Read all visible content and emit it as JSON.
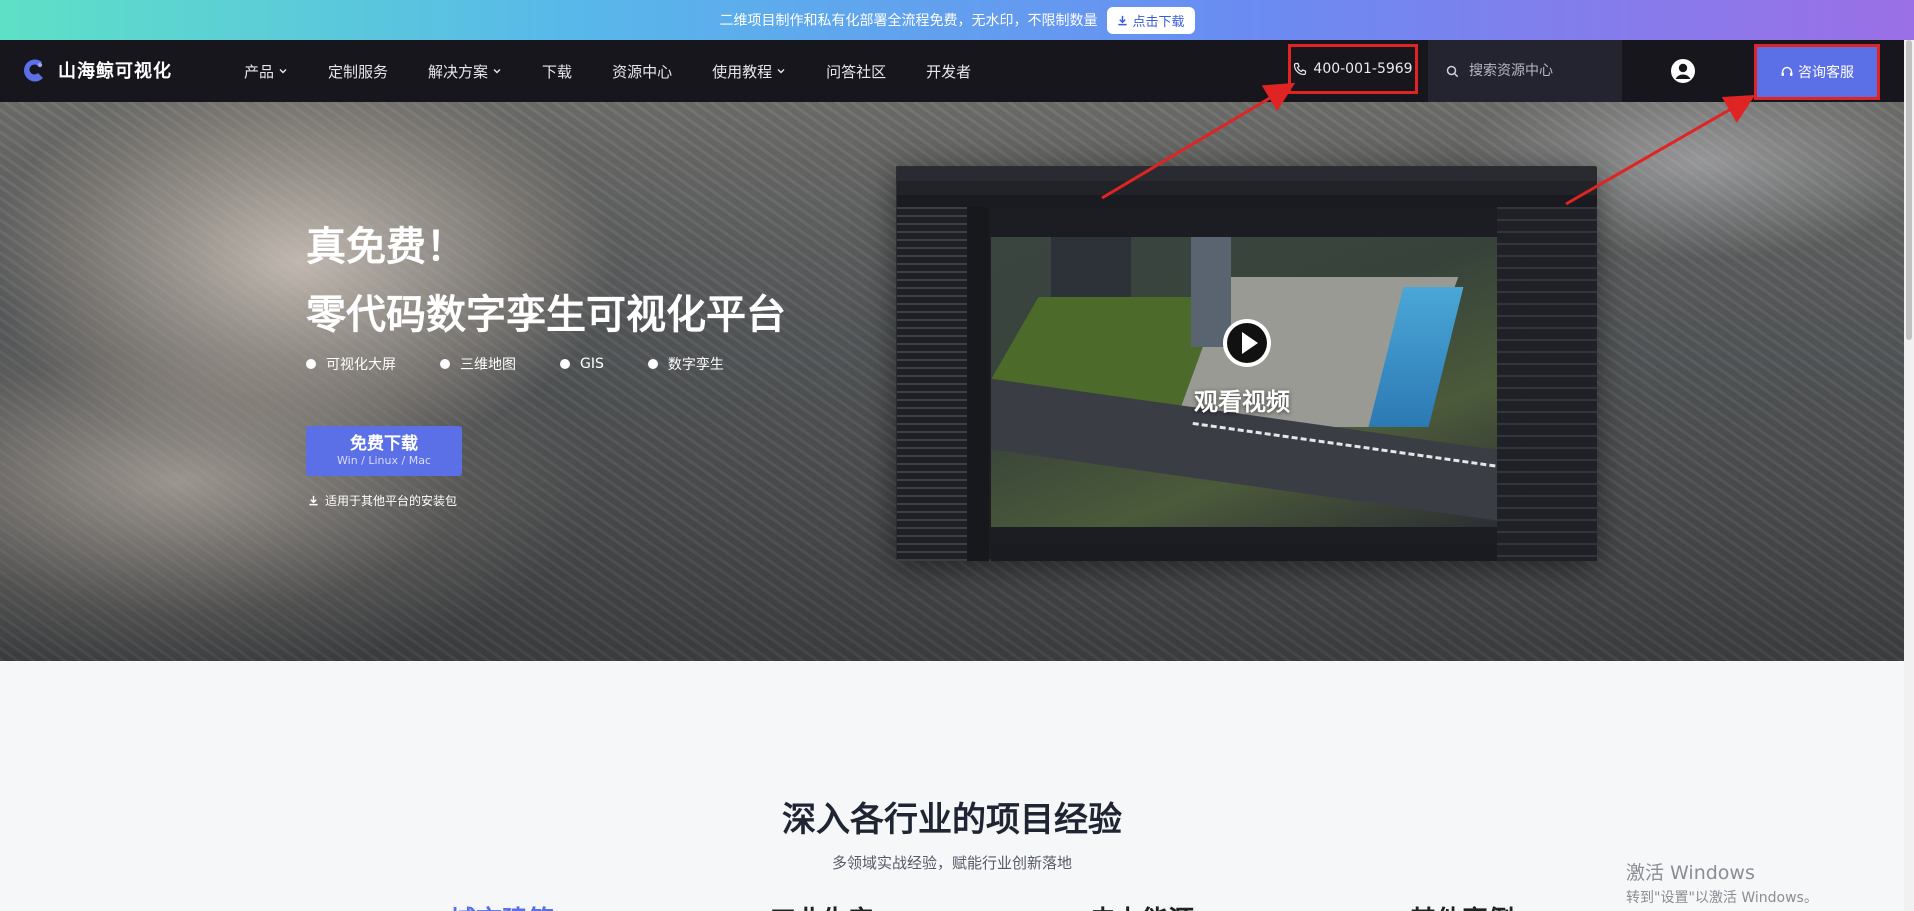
{
  "banner": {
    "text": "二维项目制作和私有化部署全流程免费，无水印，不限制数量",
    "button_label": "点击下载"
  },
  "nav": {
    "logo_text": "山海鲸可视化",
    "items": [
      {
        "label": "产品",
        "dropdown": true
      },
      {
        "label": "定制服务",
        "dropdown": false
      },
      {
        "label": "解决方案",
        "dropdown": true
      },
      {
        "label": "下载",
        "dropdown": false
      },
      {
        "label": "资源中心",
        "dropdown": false
      },
      {
        "label": "使用教程",
        "dropdown": true
      },
      {
        "label": "问答社区",
        "dropdown": false
      },
      {
        "label": "开发者",
        "dropdown": false
      }
    ],
    "phone": "400-001-5969",
    "search_placeholder": "搜索资源中心",
    "consult_label": "咨询客服"
  },
  "hero": {
    "title1": "真免费！",
    "title2": "零代码数字孪生可视化平台",
    "tags": [
      "可视化大屏",
      "三维地图",
      "GIS",
      "数字孪生"
    ],
    "download_label": "免费下载",
    "download_platforms": "Win / Linux / Mac",
    "other_packages": "适用于其他平台的安装包",
    "watch_video": "观看视频"
  },
  "section": {
    "title": "深入各行业的项目经验",
    "subtitle": "多领域实战经验，赋能行业创新落地",
    "categories": [
      "城市建筑",
      "工业生产",
      "电力能源",
      "其他案例"
    ]
  },
  "watermark": {
    "line1": "激活 Windows",
    "line2": "转到\"设置\"以激活 Windows。"
  },
  "colors": {
    "accent": "#5b6fe6",
    "nav_bg": "#16161c",
    "highlight_red": "#e02424"
  }
}
